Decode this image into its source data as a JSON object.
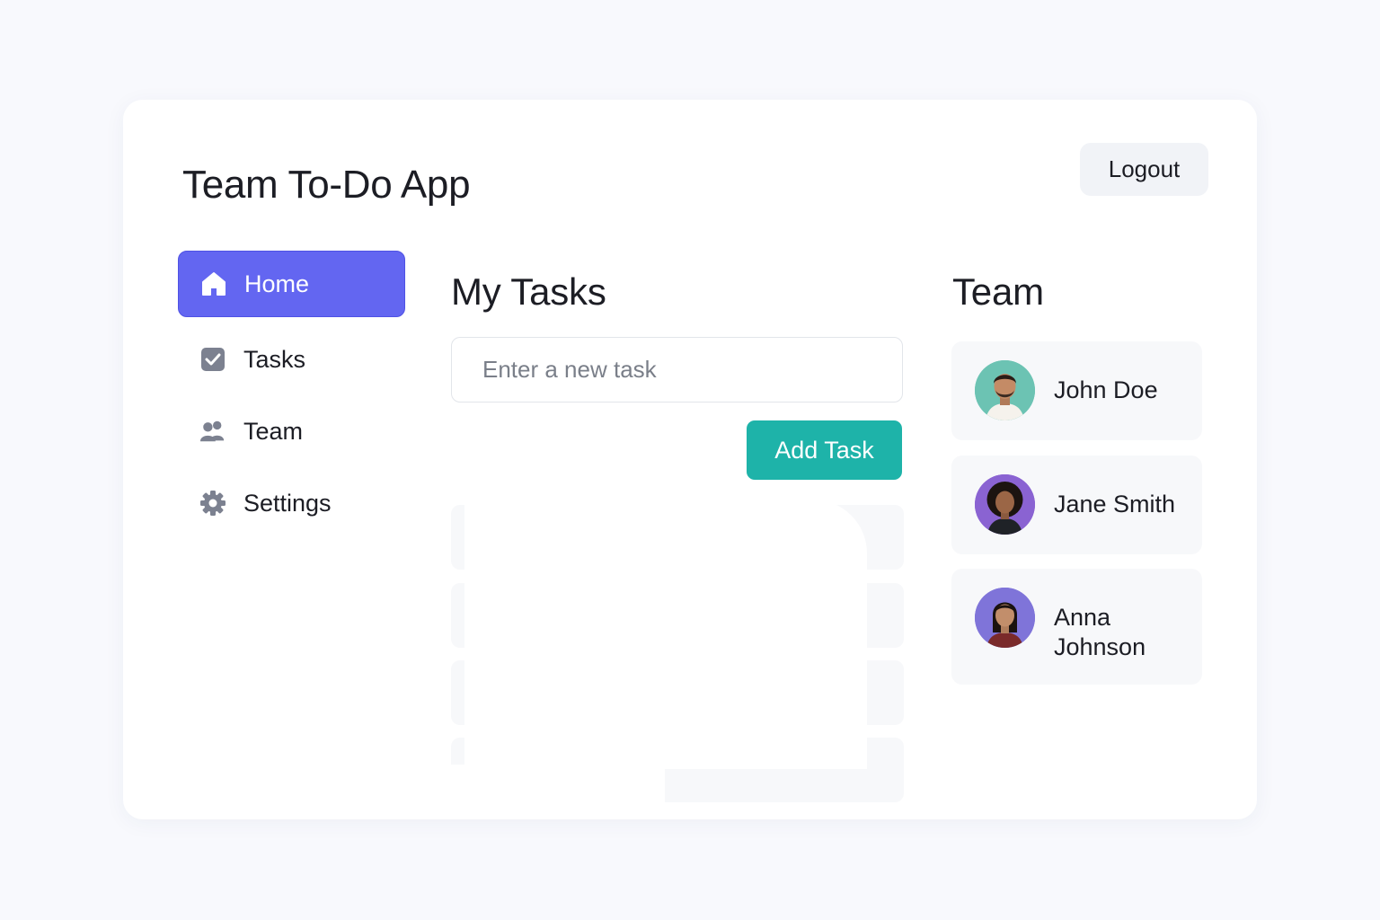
{
  "app": {
    "title": "Team To-Do App",
    "logout_label": "Logout"
  },
  "sidebar": {
    "items": [
      {
        "label": "Home",
        "icon": "home-icon",
        "active": true
      },
      {
        "label": "Tasks",
        "icon": "checkbox-icon",
        "active": false
      },
      {
        "label": "Team",
        "icon": "people-icon",
        "active": false
      },
      {
        "label": "Settings",
        "icon": "gear-icon",
        "active": false
      }
    ]
  },
  "tasks": {
    "title": "My Tasks",
    "input_placeholder": "Enter a new task",
    "input_value": "",
    "add_label": "Add Task"
  },
  "team": {
    "title": "Team",
    "members": [
      {
        "name": "John Doe",
        "avatar_bg": "#6cc3b3"
      },
      {
        "name": "Jane Smith",
        "avatar_bg": "#8a63d2"
      },
      {
        "name_line1": "Anna",
        "name_line2": "Johnson",
        "avatar_bg": "#7f74d9"
      }
    ]
  },
  "colors": {
    "accent": "#6366f1",
    "add_button": "#1eb3a9",
    "background": "#f8f9fd"
  }
}
